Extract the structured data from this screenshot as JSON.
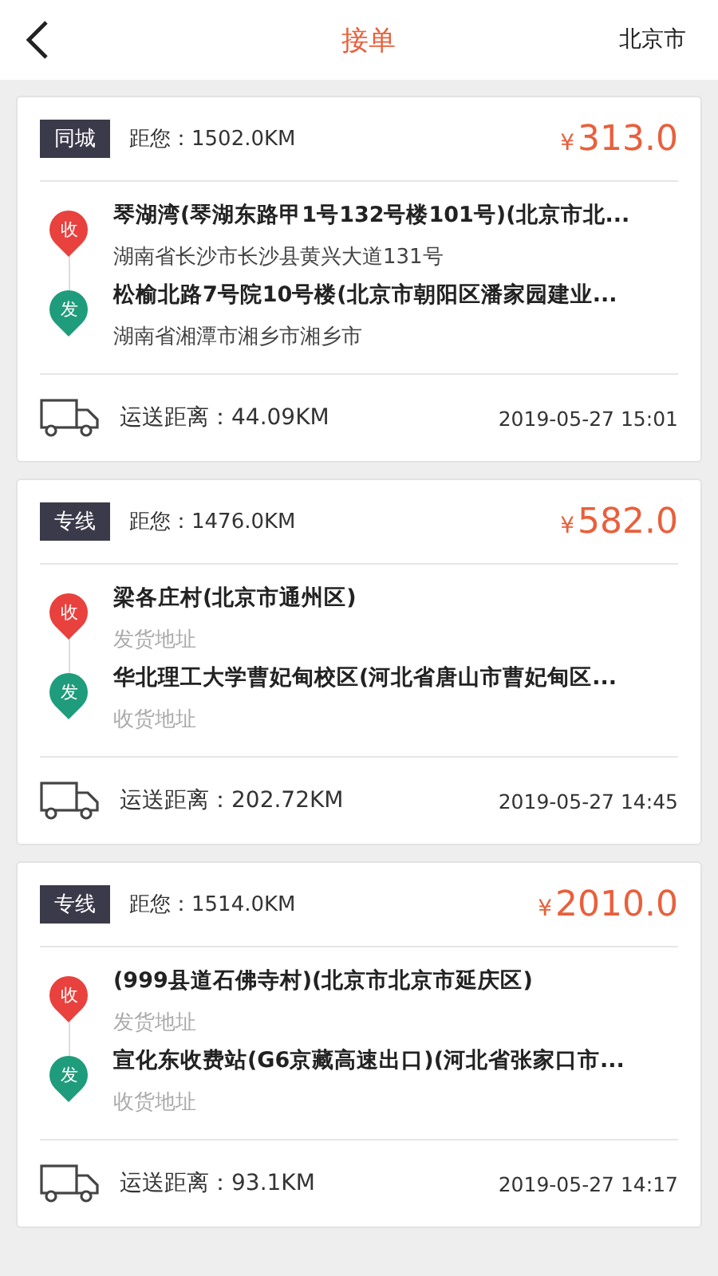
{
  "header": {
    "title": "接单",
    "city": "北京市"
  },
  "orders": [
    {
      "tag": "同城",
      "distance": "距您：1502.0KM",
      "currency": "¥",
      "price": "313.0",
      "stops": [
        {
          "pin": "收",
          "color": "#e8413e",
          "name": "琴湖湾(琴湖东路甲1号132号楼101号)(北京市北...",
          "address": "湖南省长沙市长沙县黄兴大道131号",
          "muted": false
        },
        {
          "pin": "发",
          "color": "#1f9c7c",
          "name": "松榆北路7号院10号楼(北京市朝阳区潘家园建业...",
          "address": "湖南省湘潭市湘乡市湘乡市",
          "muted": false
        }
      ],
      "shipping": "运送距离：44.09KM",
      "time": "2019-05-27 15:01"
    },
    {
      "tag": "专线",
      "distance": "距您：1476.0KM",
      "currency": "¥",
      "price": "582.0",
      "stops": [
        {
          "pin": "收",
          "color": "#e8413e",
          "name": "梁各庄村(北京市通州区)",
          "address": "发货地址",
          "muted": true
        },
        {
          "pin": "发",
          "color": "#1f9c7c",
          "name": "华北理工大学曹妃甸校区(河北省唐山市曹妃甸区...",
          "address": "收货地址",
          "muted": true
        }
      ],
      "shipping": "运送距离：202.72KM",
      "time": "2019-05-27 14:45"
    },
    {
      "tag": "专线",
      "distance": "距您：1514.0KM",
      "currency": "¥",
      "price": "2010.0",
      "stops": [
        {
          "pin": "收",
          "color": "#e8413e",
          "name": "(999县道石佛寺村)(北京市北京市延庆区)",
          "address": "发货地址",
          "muted": true
        },
        {
          "pin": "发",
          "color": "#1f9c7c",
          "name": "宣化东收费站(G6京藏高速出口)(河北省张家口市...",
          "address": "收货地址",
          "muted": true
        }
      ],
      "shipping": "运送距离：93.1KM",
      "time": "2019-05-27 14:17"
    }
  ]
}
